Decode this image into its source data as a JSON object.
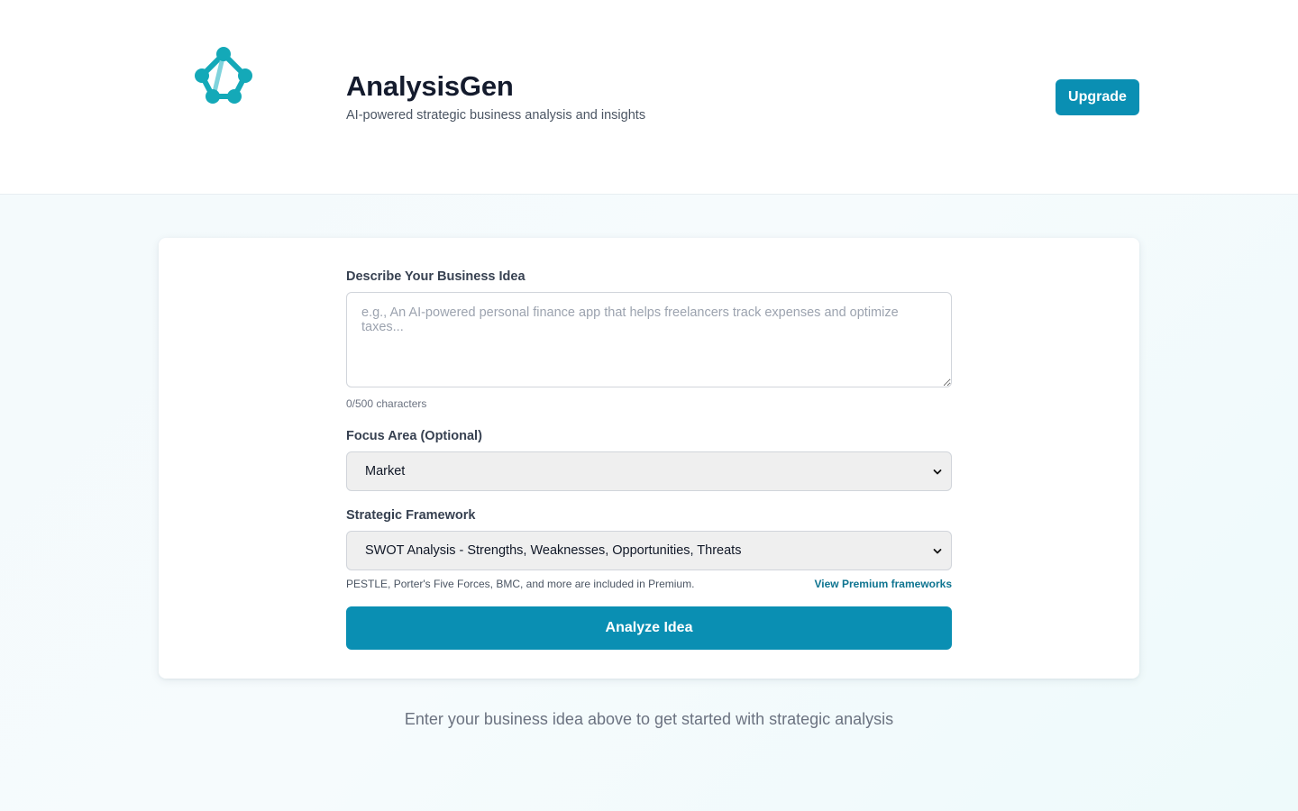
{
  "header": {
    "logo_icon": "network-polygon-icon",
    "title": "AnalysisGen",
    "subtitle": "AI-powered strategic business analysis and insights",
    "upgrade_label": "Upgrade"
  },
  "form": {
    "idea_label": "Describe Your Business Idea",
    "idea_placeholder": "e.g., An AI-powered personal finance app that helps freelancers track expenses and optimize taxes...",
    "idea_value": "",
    "char_count": "0/500 characters",
    "focus_label": "Focus Area (Optional)",
    "focus_selected": "Market",
    "framework_label": "Strategic Framework",
    "framework_selected": "SWOT Analysis - Strengths, Weaknesses, Opportunities, Threats",
    "framework_hint": "PESTLE, Porter's Five Forces, BMC, and more are included in Premium.",
    "premium_link": "View Premium frameworks",
    "analyze_label": "Analyze Idea"
  },
  "empty_state": "Enter your business idea above to get started with strategic analysis",
  "colors": {
    "accent": "#0a8fb3",
    "logo": "#14a9b8",
    "link": "#0e7490"
  }
}
